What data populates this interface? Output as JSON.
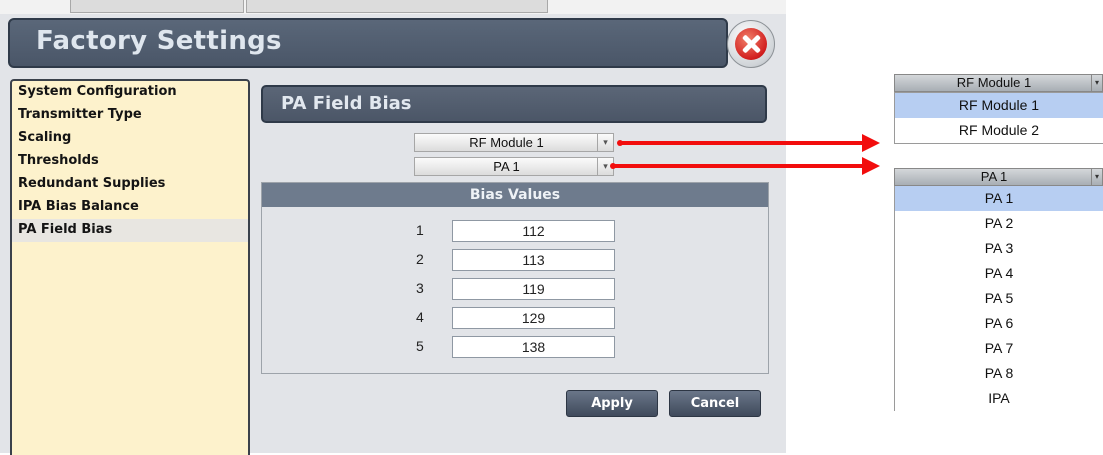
{
  "window": {
    "title": "Factory Settings"
  },
  "sidebar": {
    "items": [
      {
        "label": "System Configuration"
      },
      {
        "label": "Transmitter Type"
      },
      {
        "label": "Scaling"
      },
      {
        "label": "Thresholds"
      },
      {
        "label": "Redundant Supplies"
      },
      {
        "label": "IPA Bias Balance"
      },
      {
        "label": "PA Field Bias",
        "active": true
      }
    ]
  },
  "content": {
    "section_title": "PA Field Bias",
    "module_select": {
      "value": "RF Module 1"
    },
    "pa_select": {
      "value": "PA 1"
    },
    "bias_values": {
      "header": "Bias Values",
      "rows": [
        {
          "index": "1",
          "value": "112"
        },
        {
          "index": "2",
          "value": "113"
        },
        {
          "index": "3",
          "value": "119"
        },
        {
          "index": "4",
          "value": "129"
        },
        {
          "index": "5",
          "value": "138"
        }
      ]
    },
    "buttons": {
      "apply": "Apply",
      "cancel": "Cancel"
    }
  },
  "expanded_module_list": {
    "header": "RF Module 1",
    "options": [
      "RF Module 1",
      "RF Module 2"
    ],
    "selected": "RF Module 1"
  },
  "expanded_pa_list": {
    "header": "PA 1",
    "options": [
      "PA 1",
      "PA 2",
      "PA 3",
      "PA 4",
      "PA 5",
      "PA 6",
      "PA 7",
      "PA 8",
      "IPA"
    ],
    "selected": "PA 1"
  },
  "colors": {
    "sidebar_bg": "#fdf2cc",
    "title_bar": "#4f5b6d",
    "close_button": "#d21f1f",
    "arrow": "#f20d0d",
    "selected_option": "#b7cef2"
  }
}
